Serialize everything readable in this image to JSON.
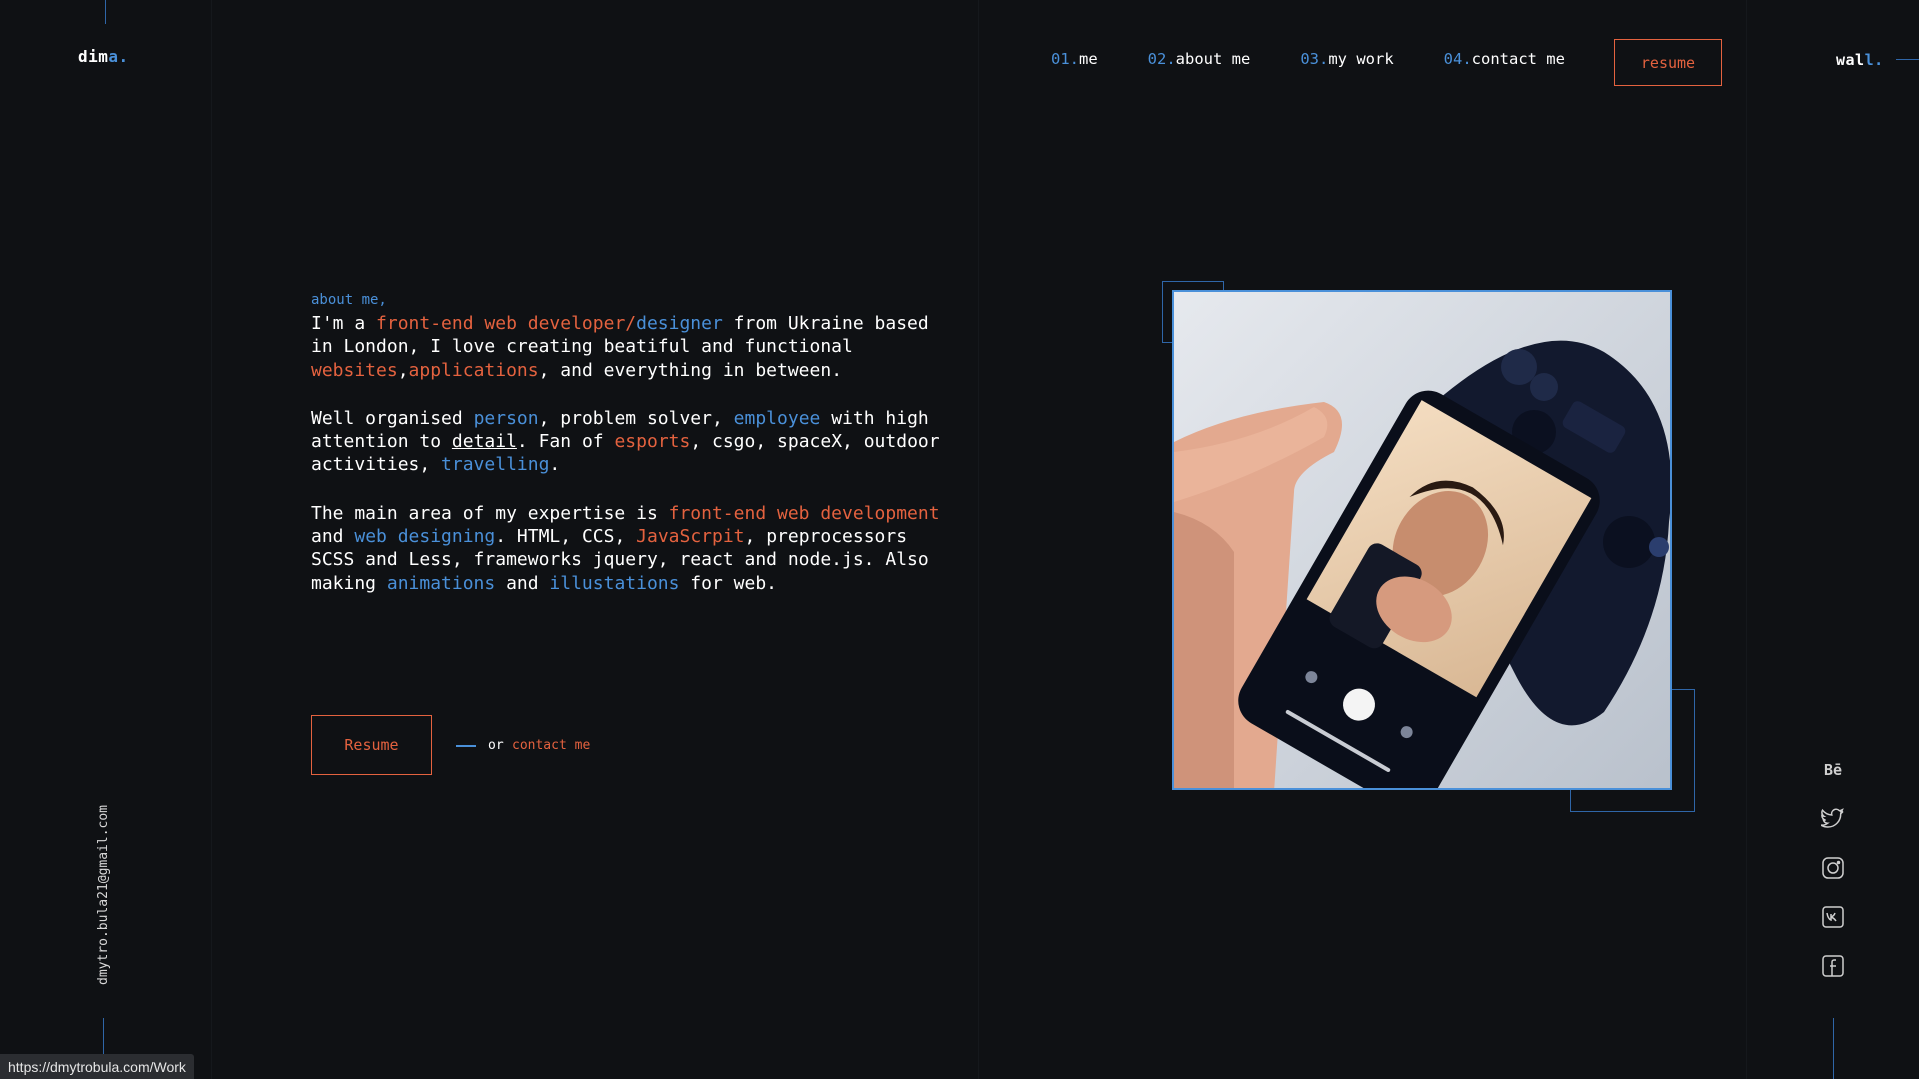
{
  "logo": {
    "name": "dim",
    "accent_letter": "a",
    "dot": "."
  },
  "wall_logo": {
    "name": "wal",
    "accent_letter": "l",
    "dot": "."
  },
  "nav": {
    "items": [
      {
        "num": "01.",
        "label": "me"
      },
      {
        "num": "02.",
        "label": "about me"
      },
      {
        "num": "03.",
        "label": "my work"
      },
      {
        "num": "04.",
        "label": "contact me"
      }
    ],
    "resume_label": "resume"
  },
  "email": "dmytro.bula21@gmail.com",
  "about": {
    "label": "about me,",
    "p1": {
      "t1": "I'm a ",
      "h1": "front-end web developer/",
      "h2": "designer",
      "t2": " from Ukraine based in London, I love creating beatiful and functional ",
      "h3": "websites",
      "t3": ",",
      "h4": "applications",
      "t4": ", and everything in between."
    },
    "p2": {
      "t1": "Well organised ",
      "h1": "person",
      "t2": ", problem solver, ",
      "h2": "employee",
      "t3": " with high attention to ",
      "u1": "detail",
      "t4": ". Fan of ",
      "h3": "esports",
      "t5": ", csgo, spaceX, outdoor activities, ",
      "h4": "travelling",
      "t6": "."
    },
    "p3": {
      "t1": "The main area of my expertise is ",
      "h1": "front-end web development",
      "t2": " and ",
      "h2": "web designing",
      "t3": ". HTML, CCS, ",
      "h3": "JavaScrpit",
      "t4": ", preprocessors SCSS and Less, frameworks jquery, react and node.js. Also making ",
      "h4": "animations",
      "t5": " and ",
      "h5": "illustations",
      "t6": " for web."
    }
  },
  "cta": {
    "button_label": "Resume",
    "or_text": "or",
    "contact_label": "contact me"
  },
  "social": [
    {
      "icon": "behance-icon",
      "glyph": "Bē"
    },
    {
      "icon": "twitter-icon"
    },
    {
      "icon": "instagram-icon"
    },
    {
      "icon": "vk-icon"
    },
    {
      "icon": "facebook-icon"
    }
  ],
  "status_url": "https://dmytrobula.com/Work",
  "colors": {
    "background": "#0f1114",
    "accent_orange": "#e4623f",
    "accent_blue": "#4a90d9"
  }
}
